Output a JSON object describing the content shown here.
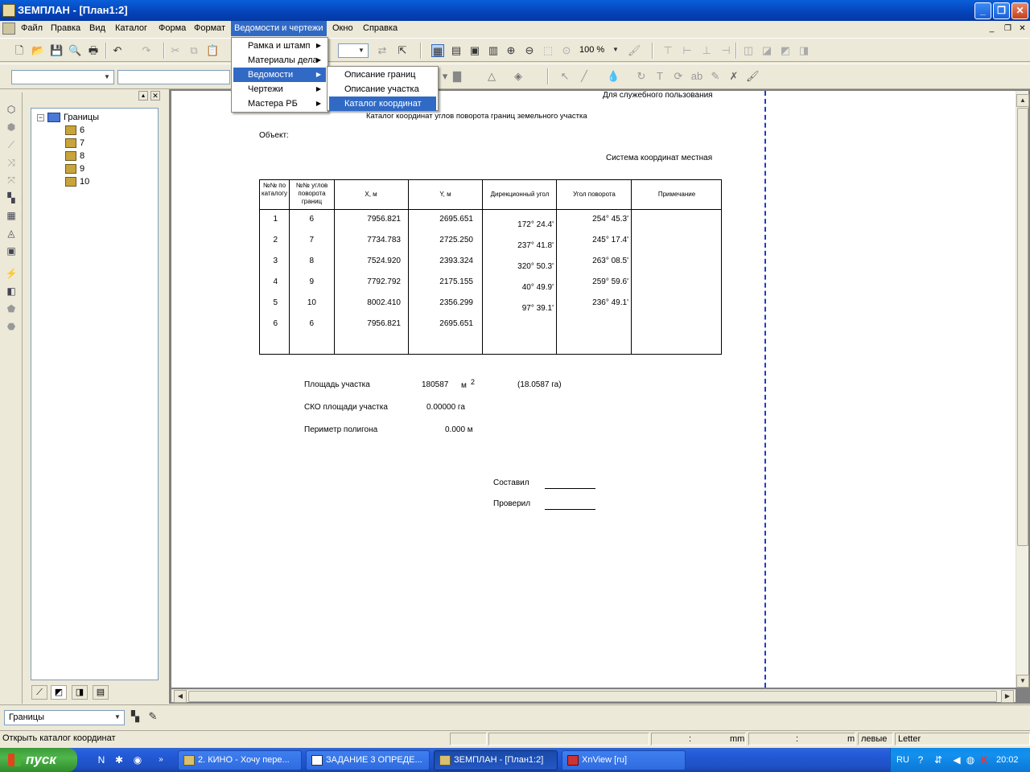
{
  "window": {
    "title": "ЗЕМПЛАН - [План1:2]",
    "controls": [
      "minimize",
      "maximize",
      "close"
    ]
  },
  "menubar": {
    "items": [
      "Файл",
      "Правка",
      "Вид",
      "Каталог",
      "Форма",
      "Формат",
      "Ведомости и чертежи",
      "Окно",
      "Справка"
    ],
    "active": "Ведомости и чертежи"
  },
  "toolbar": {
    "zoom_value": "100 %"
  },
  "menu_vedomosti": {
    "items": [
      "Рамка и штамп",
      "Материалы дела",
      "Ведомости",
      "Чертежи",
      "Мастера РБ"
    ],
    "highlighted": "Ведомости"
  },
  "submenu_vedomosti": {
    "items": [
      "Описание границ",
      "Описание участка",
      "Каталог координат"
    ],
    "highlighted": "Каталог координат"
  },
  "tree": {
    "root": "Границы",
    "children": [
      "6",
      "7",
      "8",
      "9",
      "10"
    ]
  },
  "layer_combo": {
    "value": "Границы"
  },
  "document": {
    "stamp": "Для служебного пользования",
    "heading": "Каталог координат углов поворота границ земельного участка",
    "object_label": "Объект:",
    "coord_system": "Система координат местная",
    "table": {
      "headers": [
        "№№ по каталогу",
        "№№ углов поворота границ",
        "X, м",
        "Y, м",
        "Дирекционный угол",
        "Угол поворота",
        "Примечание"
      ],
      "rows": [
        {
          "n": "1",
          "corner": "6",
          "x": "7956.821",
          "y": "2695.651",
          "turn": "254° 45.3'"
        },
        {
          "n": "2",
          "corner": "7",
          "x": "7734.783",
          "y": "2725.250",
          "turn": "245° 17.4'"
        },
        {
          "n": "3",
          "corner": "8",
          "x": "7524.920",
          "y": "2393.324",
          "turn": "263° 08.5'"
        },
        {
          "n": "4",
          "corner": "9",
          "x": "7792.792",
          "y": "2175.155",
          "turn": "259° 59.6'"
        },
        {
          "n": "5",
          "corner": "10",
          "x": "8002.410",
          "y": "2356.299",
          "turn": "236° 49.1'"
        },
        {
          "n": "6",
          "corner": "6",
          "x": "7956.821",
          "y": "2695.651",
          "turn": ""
        }
      ],
      "directional_angles": [
        "172° 24.4'",
        "237° 41.8'",
        "320° 50.3'",
        "40° 49.9'",
        "97° 39.1'"
      ]
    },
    "area_label": "Площадь участка",
    "area_value": "180587",
    "area_unit": "м",
    "area_unit_sup": "2",
    "area_ha": "(18.0587 га)",
    "sko_label": "СКО площади участка",
    "sko_value": "0.00000 га",
    "perimeter_label": "Периметр полигона",
    "perimeter_value": "0.000  м",
    "composed_label": "Составил",
    "checked_label": "Проверил"
  },
  "statusbar": {
    "message": "Открыть каталог координат",
    "coord1_sep": ":",
    "coord1_unit": "mm",
    "coord2_sep": ":",
    "coord2_unit": "m",
    "mode": "левые",
    "paper": "Letter"
  },
  "taskbar": {
    "start_label": "пуск",
    "tasks": [
      "2. КИНО - Хочу пере...",
      "ЗАДАНИЕ 3 ОПРЕДЕ...",
      "ЗЕМПЛАН - [План1:2]",
      "XnView [ru]"
    ],
    "active_task": "ЗЕМПЛАН - [План1:2]",
    "lang": "RU",
    "clock": "20:02"
  },
  "colors": {
    "titlebar": "#0a5fd9",
    "menu_highlight": "#316ac5",
    "taskbar": "#245ddb",
    "start_button": "#3c9a3a",
    "page_break": "#1f3fbf"
  }
}
